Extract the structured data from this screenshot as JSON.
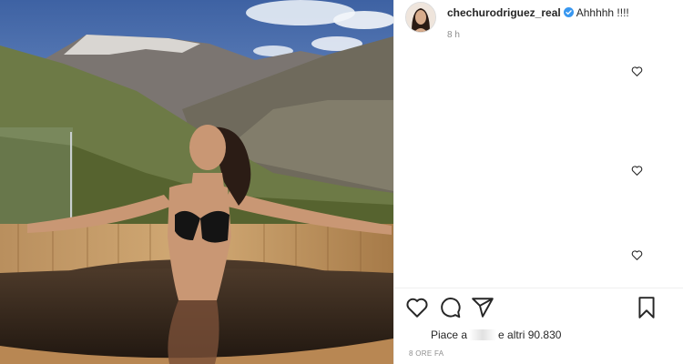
{
  "post": {
    "username": "chechurodriguez_real",
    "caption": "Ahhhhh !!!!",
    "timestamp": "8 h",
    "likes_prefix": "Piace a",
    "likes_suffix": "e altri",
    "likes_count": "90.830",
    "post_age": "8 ORE FA"
  },
  "icons": {
    "verified": "verified-badge-icon",
    "like": "heart-icon",
    "comment": "comment-icon",
    "share": "share-icon",
    "save": "bookmark-icon",
    "comment_like": "heart-icon"
  },
  "colors": {
    "verified": "#3897f0",
    "text": "#262626",
    "muted": "#8e8e8e",
    "divider": "#efefef"
  }
}
